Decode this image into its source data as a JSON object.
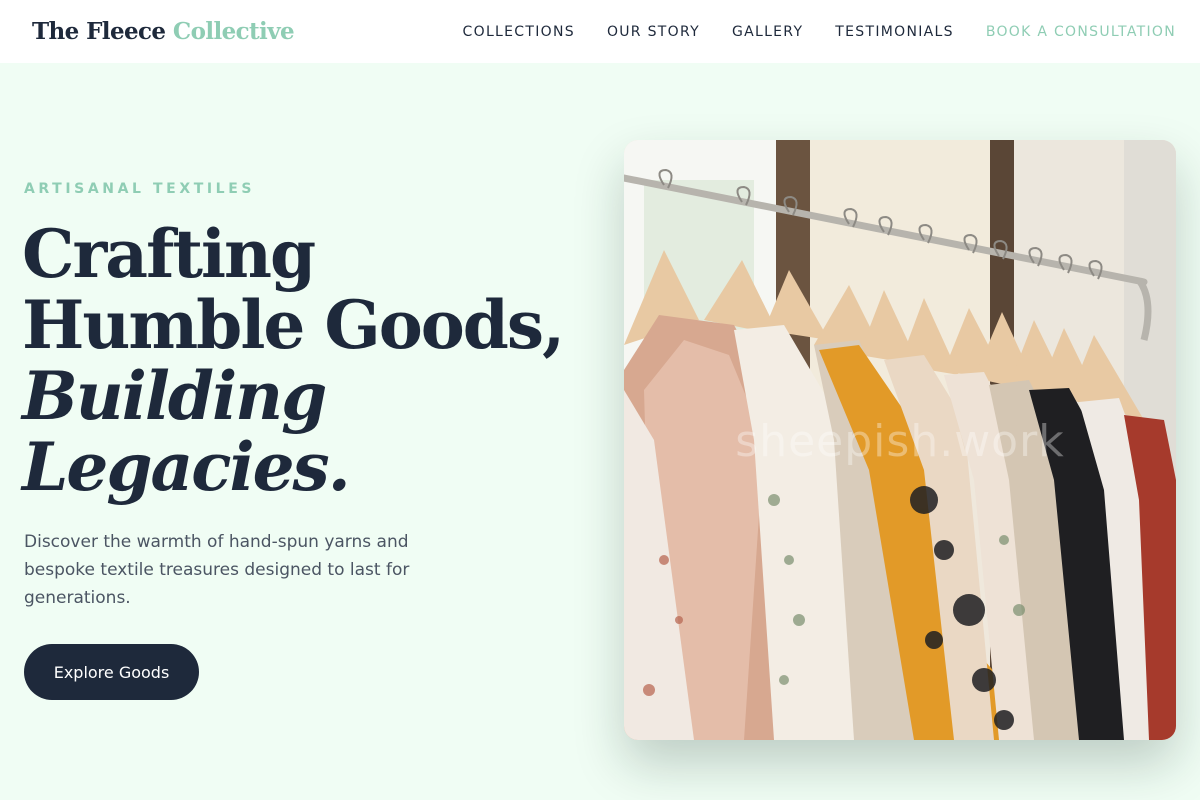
{
  "header": {
    "brand_main": "The Fleece",
    "brand_accent": "Collective",
    "nav": [
      {
        "label": "COLLECTIONS"
      },
      {
        "label": "OUR STORY"
      },
      {
        "label": "GALLERY"
      },
      {
        "label": "TESTIMONIALS"
      },
      {
        "label": "BOOK A CONSULTATION"
      }
    ]
  },
  "hero": {
    "eyebrow": "ARTISANAL TEXTILES",
    "headline_line1": "Crafting",
    "headline_line2": "Humble Goods,",
    "headline_line3": "Building",
    "headline_line4": "Legacies.",
    "description": "Discover the warmth of hand-spun yarns and bespoke textile treasures designed to last for generations.",
    "button_label": "Explore Goods",
    "image_watermark": "sheepish.work"
  },
  "colors": {
    "background": "#f0fdf4",
    "text_dark": "#1e293b",
    "accent_mint": "#8fcdb4",
    "body_text": "#4b5563"
  },
  "icons": []
}
